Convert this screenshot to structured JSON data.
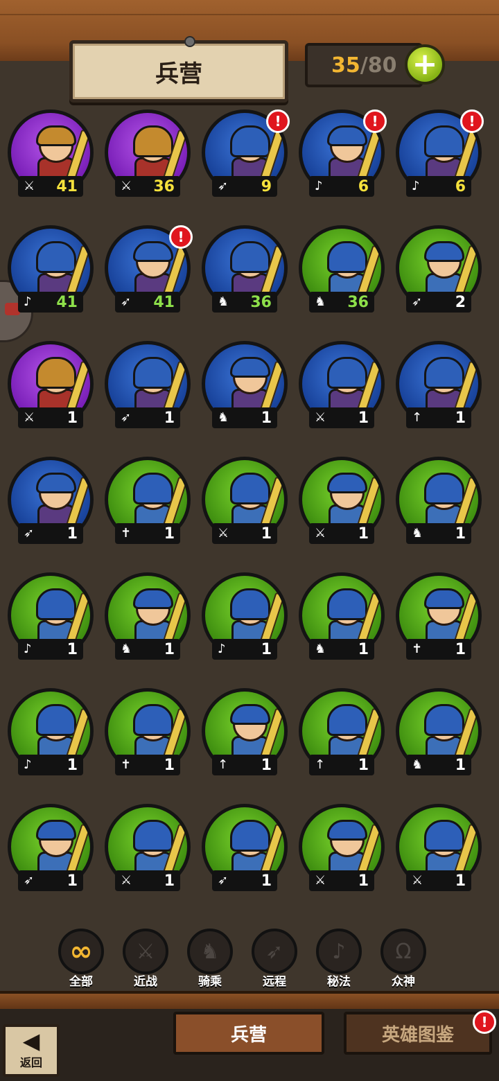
{
  "header": {
    "title": "兵营",
    "capacity_current": "35",
    "capacity_separator": "/",
    "capacity_max": "80",
    "add_label": "+"
  },
  "units": [
    {
      "frame": "purple",
      "cls": "sword",
      "cls_glyph": "⚔",
      "level": "41",
      "level_color": "gold",
      "alert": false
    },
    {
      "frame": "purple",
      "cls": "sword",
      "cls_glyph": "⚔",
      "level": "36",
      "level_color": "gold",
      "alert": false
    },
    {
      "frame": "blue",
      "cls": "bow",
      "cls_glyph": "➶",
      "level": "9",
      "level_color": "gold",
      "alert": true
    },
    {
      "frame": "blue",
      "cls": "magic",
      "cls_glyph": "♪",
      "level": "6",
      "level_color": "gold",
      "alert": true
    },
    {
      "frame": "blue",
      "cls": "magic",
      "cls_glyph": "♪",
      "level": "6",
      "level_color": "gold",
      "alert": true
    },
    {
      "frame": "blue",
      "cls": "magic",
      "cls_glyph": "♪",
      "level": "41",
      "level_color": "green",
      "alert": false
    },
    {
      "frame": "blue",
      "cls": "bow",
      "cls_glyph": "➶",
      "level": "41",
      "level_color": "green",
      "alert": true
    },
    {
      "frame": "blue",
      "cls": "mount",
      "cls_glyph": "♞",
      "level": "36",
      "level_color": "green",
      "alert": false
    },
    {
      "frame": "green",
      "cls": "mount",
      "cls_glyph": "♞",
      "level": "36",
      "level_color": "green",
      "alert": false
    },
    {
      "frame": "green",
      "cls": "bow",
      "cls_glyph": "➶",
      "level": "2",
      "level_color": "white",
      "alert": false
    },
    {
      "frame": "purple",
      "cls": "sword",
      "cls_glyph": "⚔",
      "level": "1",
      "level_color": "white",
      "alert": false
    },
    {
      "frame": "blue",
      "cls": "bow",
      "cls_glyph": "➶",
      "level": "1",
      "level_color": "white",
      "alert": false
    },
    {
      "frame": "blue",
      "cls": "mount",
      "cls_glyph": "♞",
      "level": "1",
      "level_color": "white",
      "alert": false
    },
    {
      "frame": "blue",
      "cls": "sword",
      "cls_glyph": "⚔",
      "level": "1",
      "level_color": "white",
      "alert": false
    },
    {
      "frame": "blue",
      "cls": "spear",
      "cls_glyph": "↑",
      "level": "1",
      "level_color": "white",
      "alert": false
    },
    {
      "frame": "blue",
      "cls": "bow",
      "cls_glyph": "➶",
      "level": "1",
      "level_color": "white",
      "alert": false
    },
    {
      "frame": "green",
      "cls": "holy",
      "cls_glyph": "✝",
      "level": "1",
      "level_color": "white",
      "alert": false
    },
    {
      "frame": "green",
      "cls": "sword",
      "cls_glyph": "⚔",
      "level": "1",
      "level_color": "white",
      "alert": false
    },
    {
      "frame": "green",
      "cls": "sword",
      "cls_glyph": "⚔",
      "level": "1",
      "level_color": "white",
      "alert": false
    },
    {
      "frame": "green",
      "cls": "mount",
      "cls_glyph": "♞",
      "level": "1",
      "level_color": "white",
      "alert": false
    },
    {
      "frame": "green",
      "cls": "magic",
      "cls_glyph": "♪",
      "level": "1",
      "level_color": "white",
      "alert": false
    },
    {
      "frame": "green",
      "cls": "mount",
      "cls_glyph": "♞",
      "level": "1",
      "level_color": "white",
      "alert": false
    },
    {
      "frame": "green",
      "cls": "magic",
      "cls_glyph": "♪",
      "level": "1",
      "level_color": "white",
      "alert": false
    },
    {
      "frame": "green",
      "cls": "mount",
      "cls_glyph": "♞",
      "level": "1",
      "level_color": "white",
      "alert": false
    },
    {
      "frame": "green",
      "cls": "holy",
      "cls_glyph": "✝",
      "level": "1",
      "level_color": "white",
      "alert": false
    },
    {
      "frame": "green",
      "cls": "magic",
      "cls_glyph": "♪",
      "level": "1",
      "level_color": "white",
      "alert": false
    },
    {
      "frame": "green",
      "cls": "holy",
      "cls_glyph": "✝",
      "level": "1",
      "level_color": "white",
      "alert": false
    },
    {
      "frame": "green",
      "cls": "spear",
      "cls_glyph": "↑",
      "level": "1",
      "level_color": "white",
      "alert": false
    },
    {
      "frame": "green",
      "cls": "spear",
      "cls_glyph": "↑",
      "level": "1",
      "level_color": "white",
      "alert": false
    },
    {
      "frame": "green",
      "cls": "mount",
      "cls_glyph": "♞",
      "level": "1",
      "level_color": "white",
      "alert": false
    },
    {
      "frame": "green",
      "cls": "bow",
      "cls_glyph": "➶",
      "level": "1",
      "level_color": "white",
      "alert": false
    },
    {
      "frame": "green",
      "cls": "sword",
      "cls_glyph": "⚔",
      "level": "1",
      "level_color": "white",
      "alert": false
    },
    {
      "frame": "green",
      "cls": "bow",
      "cls_glyph": "➶",
      "level": "1",
      "level_color": "white",
      "alert": false
    },
    {
      "frame": "green",
      "cls": "sword",
      "cls_glyph": "⚔",
      "level": "1",
      "level_color": "white",
      "alert": false
    },
    {
      "frame": "green",
      "cls": "sword",
      "cls_glyph": "⚔",
      "level": "1",
      "level_color": "white",
      "alert": false
    }
  ],
  "alert_glyph": "!",
  "filters": [
    {
      "label": "全部",
      "glyph": "∞",
      "active": true
    },
    {
      "label": "近战",
      "glyph": "⚔",
      "active": false
    },
    {
      "label": "骑乘",
      "glyph": "♞",
      "active": false
    },
    {
      "label": "远程",
      "glyph": "➶",
      "active": false
    },
    {
      "label": "秘法",
      "glyph": "♪",
      "active": false
    },
    {
      "label": "众神",
      "glyph": "Ω",
      "active": false
    }
  ],
  "bottom": {
    "back_arrow": "◀",
    "back_label": "返回",
    "tab_barracks": "兵营",
    "tab_heroes": "英雄图鉴",
    "tab_alert": "!"
  },
  "colors": {
    "frame_purple": "#8a2bd0",
    "frame_blue": "#1f4fb0",
    "frame_green": "#4fa81a",
    "level_gold": "#f5e13c",
    "level_green": "#8ee04a",
    "alert_red": "#e0161e",
    "capacity_gold": "#f2b632"
  }
}
